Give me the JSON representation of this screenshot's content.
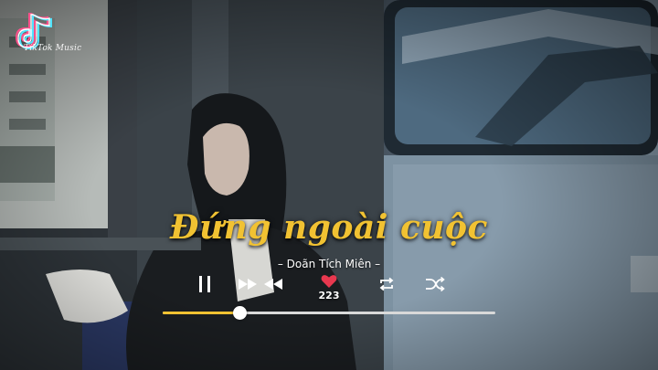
{
  "logo": {
    "text": "TikTok Music"
  },
  "song": {
    "title": "Đứng ngoài cuộc",
    "artist": "– Doãn Tích Miên –"
  },
  "controls": {
    "like_count": "223"
  },
  "progress": {
    "fraction": 0.23
  },
  "colors": {
    "accent": "#f1c232",
    "heart": "#e8384f",
    "track": "#d9d9d9"
  },
  "icons": [
    "pause-icon",
    "fast-forward-icon",
    "rewind-icon",
    "heart-icon",
    "repeat-icon",
    "shuffle-icon"
  ]
}
